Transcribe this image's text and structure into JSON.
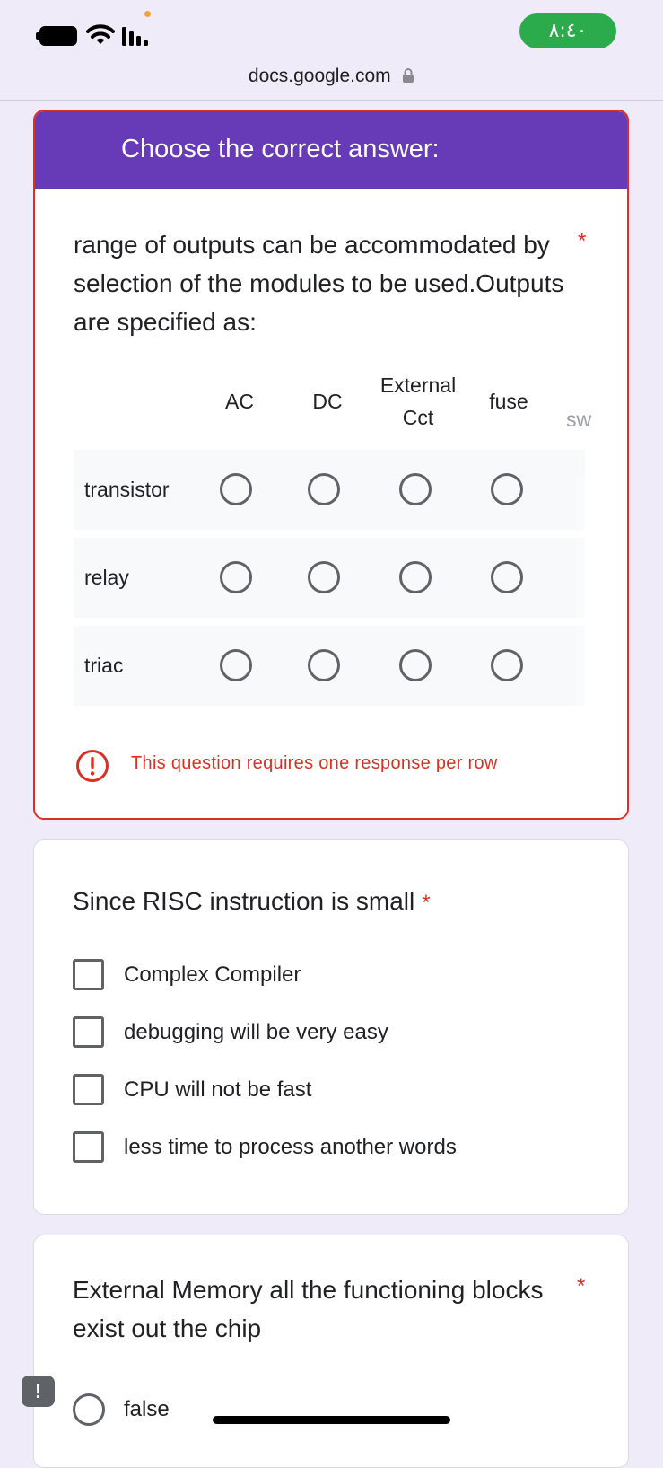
{
  "status_bar": {
    "time": "٨:٤٠",
    "icons": [
      "battery-icon",
      "wifi-icon",
      "signal-icon"
    ]
  },
  "browser": {
    "url": "docs.google.com"
  },
  "section": {
    "title": "Choose the correct answer:"
  },
  "question1": {
    "text": "range of outputs can be accommodated by selection of the modules to be used.Outputs are specified as:",
    "required_mark": "*",
    "columns": [
      "AC",
      "DC",
      "External Cct",
      "fuse",
      "sw"
    ],
    "rows": [
      "transistor",
      "relay",
      "triac"
    ],
    "error": "This question requires one response per row"
  },
  "question2": {
    "title": "Since RISC instruction is small",
    "required_mark": "*",
    "options": [
      "Complex Compiler",
      "debugging will be very easy",
      "CPU will not be fast",
      "less time to process another words"
    ]
  },
  "question3": {
    "title": "External Memory all the functioning blocks exist out the chip",
    "required_mark": "*",
    "options": [
      "false"
    ]
  },
  "feedback": {
    "label": "!"
  },
  "colors": {
    "header": "#673ab7",
    "error": "#d93025",
    "background": "#efebf8",
    "time_pill": "#2bab4c"
  }
}
